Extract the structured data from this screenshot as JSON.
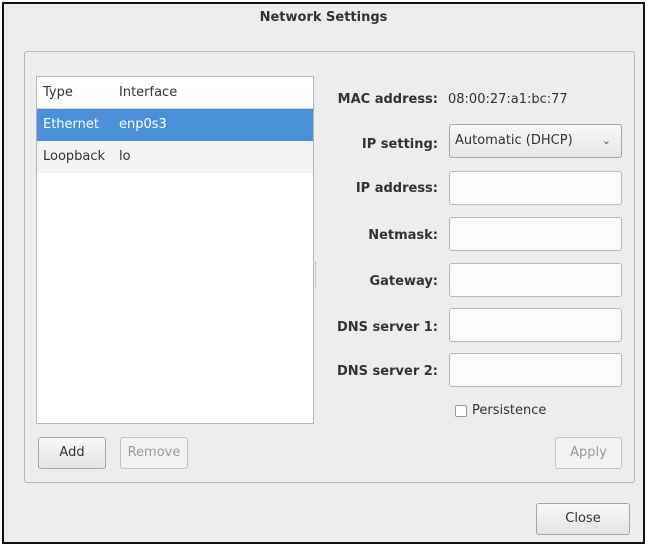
{
  "window": {
    "title": "Network Settings"
  },
  "interfaces": {
    "headers": {
      "type": "Type",
      "interface": "Interface"
    },
    "rows": [
      {
        "type": "Ethernet",
        "interface": "enp0s3",
        "selected": true
      },
      {
        "type": "Loopback",
        "interface": "lo",
        "selected": false
      }
    ]
  },
  "buttons": {
    "add": "Add",
    "remove": "Remove",
    "apply": "Apply",
    "close": "Close"
  },
  "details": {
    "mac_label": "MAC address:",
    "mac_value": "08:00:27:a1:bc:77",
    "ip_setting_label": "IP setting:",
    "ip_setting_value": "Automatic (DHCP)",
    "ip_address_label": "IP address:",
    "netmask_label": "Netmask:",
    "gateway_label": "Gateway:",
    "dns1_label": "DNS server 1:",
    "dns2_label": "DNS server 2:",
    "persistence_label": "Persistence"
  },
  "colors": {
    "selection": "#4a90d9"
  },
  "icons": {
    "dropdown": "chevron-down-icon"
  }
}
